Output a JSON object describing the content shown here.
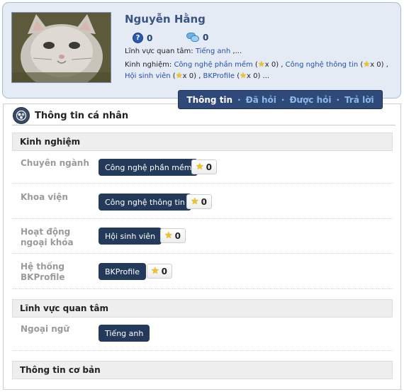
{
  "profile": {
    "name": "Nguyễn Hằng",
    "questions_count": "0",
    "answers_count": "0",
    "interests_label": "Lĩnh vực quan tâm:",
    "interests_value": "Tiếng anh",
    "interests_more": ",...",
    "experience_label": "Kinh nghiệm:",
    "experience_items": [
      {
        "name": "Công nghệ phần mềm",
        "count": "x 0"
      },
      {
        "name": "Công nghệ thông tin",
        "count": "x 0"
      },
      {
        "name": "Hội sinh viên",
        "count": "x 0"
      },
      {
        "name": "BKProfile",
        "count": "x 0"
      }
    ],
    "experience_tail": "..."
  },
  "tabs": [
    {
      "label": "Thông tin",
      "active": true
    },
    {
      "label": "Đã hỏi",
      "active": false
    },
    {
      "label": "Được hỏi",
      "active": false
    },
    {
      "label": "Trả lời",
      "active": false
    }
  ],
  "section": {
    "title": "Thông tin cá nhân",
    "groups": {
      "experience": "Kinh nghiệm",
      "interests": "Lĩnh vực quan tâm",
      "basic": "Thông tin cơ bản"
    },
    "rows": [
      {
        "label": "Chuyên ngành",
        "tag": "Công nghệ phần mềm",
        "stars": "0"
      },
      {
        "label": "Khoa viện",
        "tag": "Công nghệ thông tin",
        "stars": "0"
      },
      {
        "label_line1": "Hoạt động",
        "label_line2": "ngoại khóa",
        "tag": "Hội sinh viên",
        "stars": "0"
      },
      {
        "label_line1": "Hệ thống",
        "label_line2": "BKProfile",
        "tag": "BKProfile",
        "stars": "0"
      }
    ],
    "interest_row": {
      "label": "Ngoại ngữ",
      "tag": "Tiếng anh"
    }
  },
  "icons": {
    "question": "question-circle-icon",
    "answer": "speech-bubbles-icon",
    "star": "star-icon",
    "section": "profile-badge-icon"
  },
  "colors": {
    "header_bg": "#e4ebf5",
    "tabbar_bg": "#2f4a78",
    "tag_bg": "#243a5a",
    "link": "#2451a8",
    "star": "#f0c419"
  }
}
